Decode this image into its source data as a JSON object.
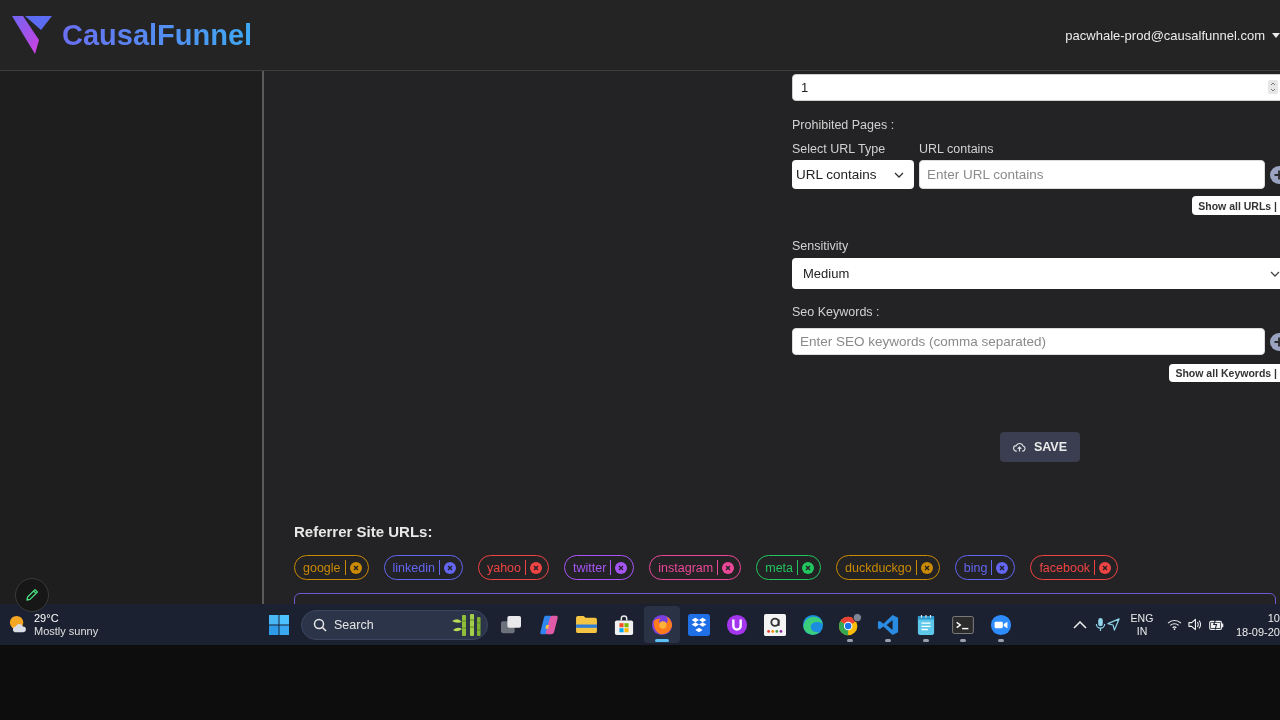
{
  "header": {
    "brand": "CausalFunnel",
    "account": "pacwhale-prod@causalfunnel.com"
  },
  "form": {
    "number_field": {
      "value": "1"
    },
    "prohibited_pages": {
      "label": "Prohibited Pages :",
      "url_type": {
        "label": "Select URL Type",
        "value": "URL contains"
      },
      "url_input": {
        "label": "URL contains",
        "placeholder": "Enter URL contains"
      },
      "show_all_button": "Show all URLs |"
    },
    "sensitivity": {
      "label": "Sensitivity",
      "value": "Medium"
    },
    "seo_keywords": {
      "label": "Seo Keywords :",
      "placeholder": "Enter SEO keywords (comma separated)",
      "show_all_button": "Show all Keywords |"
    },
    "save_button": "SAVE"
  },
  "referrer_sites": {
    "title": "Referrer Site URLs:",
    "tags": [
      {
        "label": "google",
        "color": "#ca8a04"
      },
      {
        "label": "linkedin",
        "color": "#6366f1"
      },
      {
        "label": "yahoo",
        "color": "#ef4444"
      },
      {
        "label": "twitter",
        "color": "#a855f7"
      },
      {
        "label": "instagram",
        "color": "#ec4899"
      },
      {
        "label": "meta",
        "color": "#22c55e"
      },
      {
        "label": "duckduckgo",
        "color": "#ca8a04"
      },
      {
        "label": "bing",
        "color": "#6366f1"
      },
      {
        "label": "facebook",
        "color": "#ef4444"
      }
    ]
  },
  "taskbar": {
    "weather": {
      "temperature": "29°C",
      "condition": "Mostly sunny"
    },
    "search_button": "Search",
    "apps": [
      {
        "kind": "stack",
        "running": false,
        "selected": false
      },
      {
        "kind": "swirl",
        "running": false,
        "selected": false
      },
      {
        "kind": "folder",
        "running": false,
        "selected": false
      },
      {
        "kind": "bag",
        "running": false,
        "selected": false
      },
      {
        "kind": "flame",
        "running": true,
        "selected": true
      },
      {
        "kind": "diamonds",
        "running": false,
        "selected": false
      },
      {
        "kind": "horseshoe",
        "running": false,
        "selected": false
      },
      {
        "kind": "smile",
        "running": false,
        "selected": false
      },
      {
        "kind": "wave",
        "running": false,
        "selected": false
      },
      {
        "kind": "ring",
        "running": true,
        "selected": false
      },
      {
        "kind": "ribbon",
        "running": true,
        "selected": false
      },
      {
        "kind": "notepad",
        "running": true,
        "selected": false
      },
      {
        "kind": "terminal",
        "running": true,
        "selected": false
      },
      {
        "kind": "camera",
        "running": true,
        "selected": false
      }
    ],
    "language": "ENG",
    "region": "IN",
    "time": "10",
    "date": "18-09-20"
  }
}
